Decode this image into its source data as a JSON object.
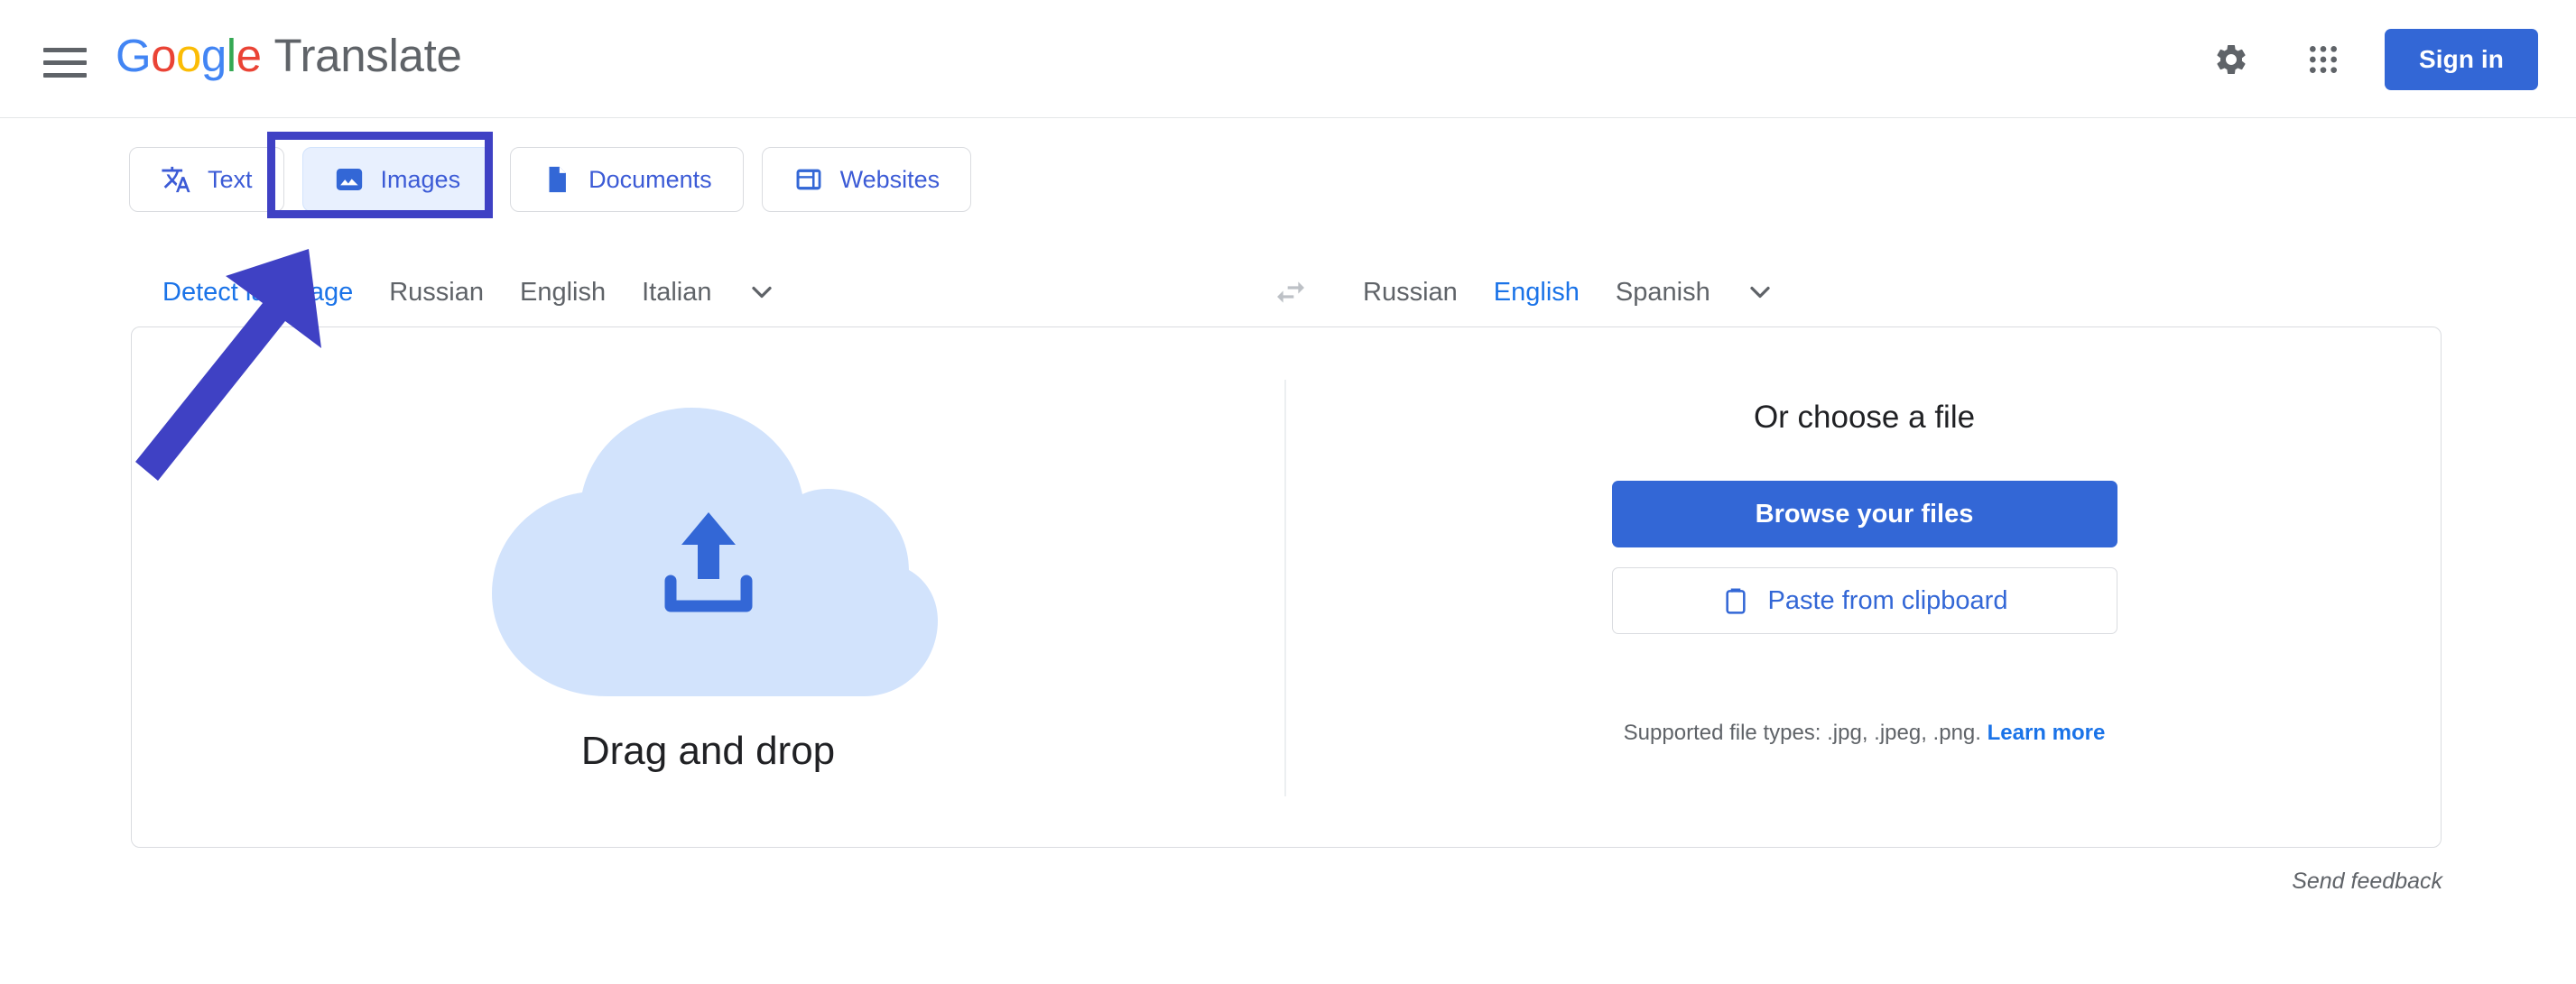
{
  "header": {
    "menu_icon": "hamburger-menu-icon",
    "logo": {
      "text": "Google",
      "letters": [
        "G",
        "o",
        "o",
        "g",
        "l",
        "e"
      ]
    },
    "product_name": "Translate",
    "settings_icon": "gear-icon",
    "apps_icon": "google-apps-grid-icon",
    "signin_label": "Sign in"
  },
  "tabs": [
    {
      "label": "Text",
      "icon": "translate-text-icon",
      "active": false
    },
    {
      "label": "Images",
      "icon": "image-icon",
      "active": true
    },
    {
      "label": "Documents",
      "icon": "document-icon",
      "active": false
    },
    {
      "label": "Websites",
      "icon": "website-layout-icon",
      "active": false
    }
  ],
  "source_languages": {
    "items": [
      {
        "label": "Detect language",
        "active": true
      },
      {
        "label": "Russian",
        "active": false
      },
      {
        "label": "English",
        "active": false
      },
      {
        "label": "Italian",
        "active": false
      }
    ],
    "more_icon": "chevron-down-icon"
  },
  "swap_icon": "swap-languages-icon",
  "target_languages": {
    "items": [
      {
        "label": "Russian",
        "active": false
      },
      {
        "label": "English",
        "active": true
      },
      {
        "label": "Spanish",
        "active": false
      }
    ],
    "more_icon": "chevron-down-icon"
  },
  "dropzone": {
    "cloud_icon": "cloud-upload-icon",
    "label": "Drag and drop"
  },
  "file_panel": {
    "title": "Or choose a file",
    "browse_label": "Browse your files",
    "paste_label": "Paste from clipboard",
    "paste_icon": "clipboard-icon",
    "supported_text": "Supported file types: .jpg, .jpeg, .png.",
    "learn_more_label": "Learn more"
  },
  "footer": {
    "send_feedback": "Send feedback"
  },
  "annotation": {
    "highlight_target": "Images",
    "arrow_icon": "pointer-arrow-icon",
    "color": "#3f41c4"
  },
  "colors": {
    "google_blue": "#4285F4",
    "google_red": "#EA4335",
    "google_yellow": "#FBBC05",
    "google_green": "#34A853",
    "primary_button": "#3367d6",
    "active_link": "#1a73e8",
    "tab_text": "#3c5bd6",
    "muted_text": "#5f6368",
    "annotation": "#3f41c4",
    "cloud_fill": "#d2e3fc"
  }
}
